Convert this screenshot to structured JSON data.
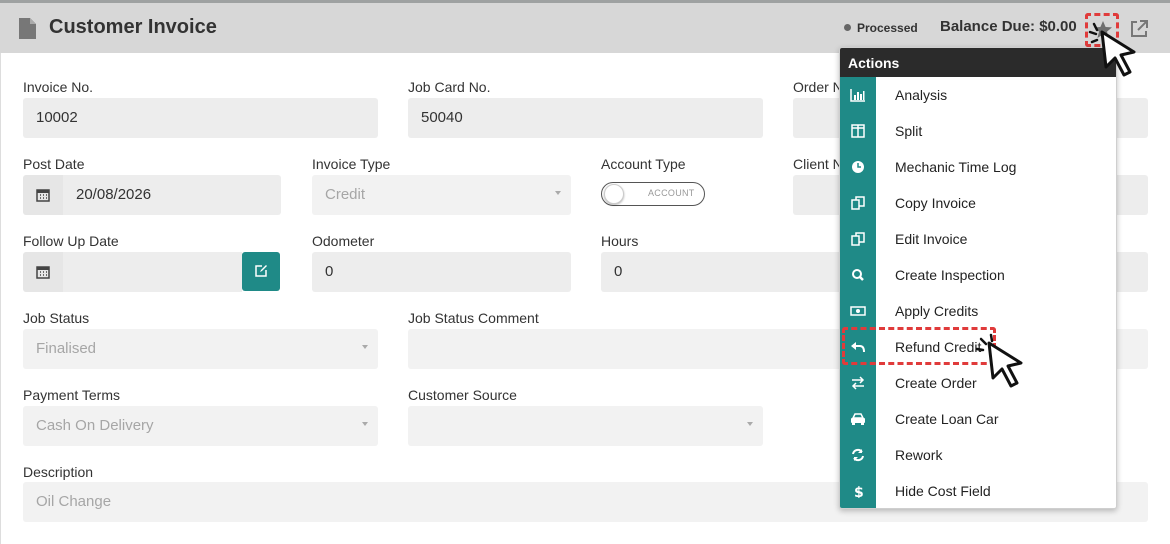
{
  "header": {
    "title": "Customer Invoice",
    "status": "Processed",
    "balance": "Balance Due: $0.00",
    "star_icon": "star-icon",
    "external_icon": "external-link-icon"
  },
  "colors": {
    "accent": "#1f8a87",
    "highlight": "#e03b3b",
    "menu_header": "#2b2b2b"
  },
  "form": {
    "invoice_no": {
      "label": "Invoice No.",
      "value": "10002"
    },
    "job_card_no": {
      "label": "Job Card No.",
      "value": "50040"
    },
    "order_no": {
      "label": "Order N"
    },
    "post_date": {
      "label": "Post Date",
      "value": "20/08/2026"
    },
    "invoice_type": {
      "label": "Invoice Type",
      "value": "Credit"
    },
    "account_type": {
      "label": "Account Type",
      "toggle_text": "ACCOUNT"
    },
    "client": {
      "label": "Client N"
    },
    "follow_up_date": {
      "label": "Follow Up Date",
      "value": ""
    },
    "odometer": {
      "label": "Odometer",
      "value": "0"
    },
    "hours": {
      "label": "Hours",
      "value": "0"
    },
    "job_status": {
      "label": "Job Status",
      "value": "Finalised"
    },
    "job_status_comment": {
      "label": "Job Status Comment",
      "value": ""
    },
    "payment_terms": {
      "label": "Payment Terms",
      "value": "Cash On Delivery"
    },
    "customer_source": {
      "label": "Customer Source",
      "value": ""
    },
    "description": {
      "label": "Description",
      "placeholder": "Oil Change"
    }
  },
  "menu": {
    "title": "Actions",
    "items": [
      {
        "label": "Analysis",
        "icon": "bar-chart-icon"
      },
      {
        "label": "Split",
        "icon": "columns-icon"
      },
      {
        "label": "Mechanic Time Log",
        "icon": "clock-icon"
      },
      {
        "label": "Copy Invoice",
        "icon": "copy-icon"
      },
      {
        "label": "Edit Invoice",
        "icon": "copy-icon"
      },
      {
        "label": "Create Inspection",
        "icon": "search-icon"
      },
      {
        "label": "Apply Credits",
        "icon": "money-icon"
      },
      {
        "label": "Refund Credit",
        "icon": "reply-icon"
      },
      {
        "label": "Create Order",
        "icon": "exchange-icon"
      },
      {
        "label": "Create Loan Car",
        "icon": "car-icon"
      },
      {
        "label": "Rework",
        "icon": "refresh-icon"
      },
      {
        "label": "Hide Cost Field",
        "icon": "dollar-icon"
      }
    ]
  }
}
